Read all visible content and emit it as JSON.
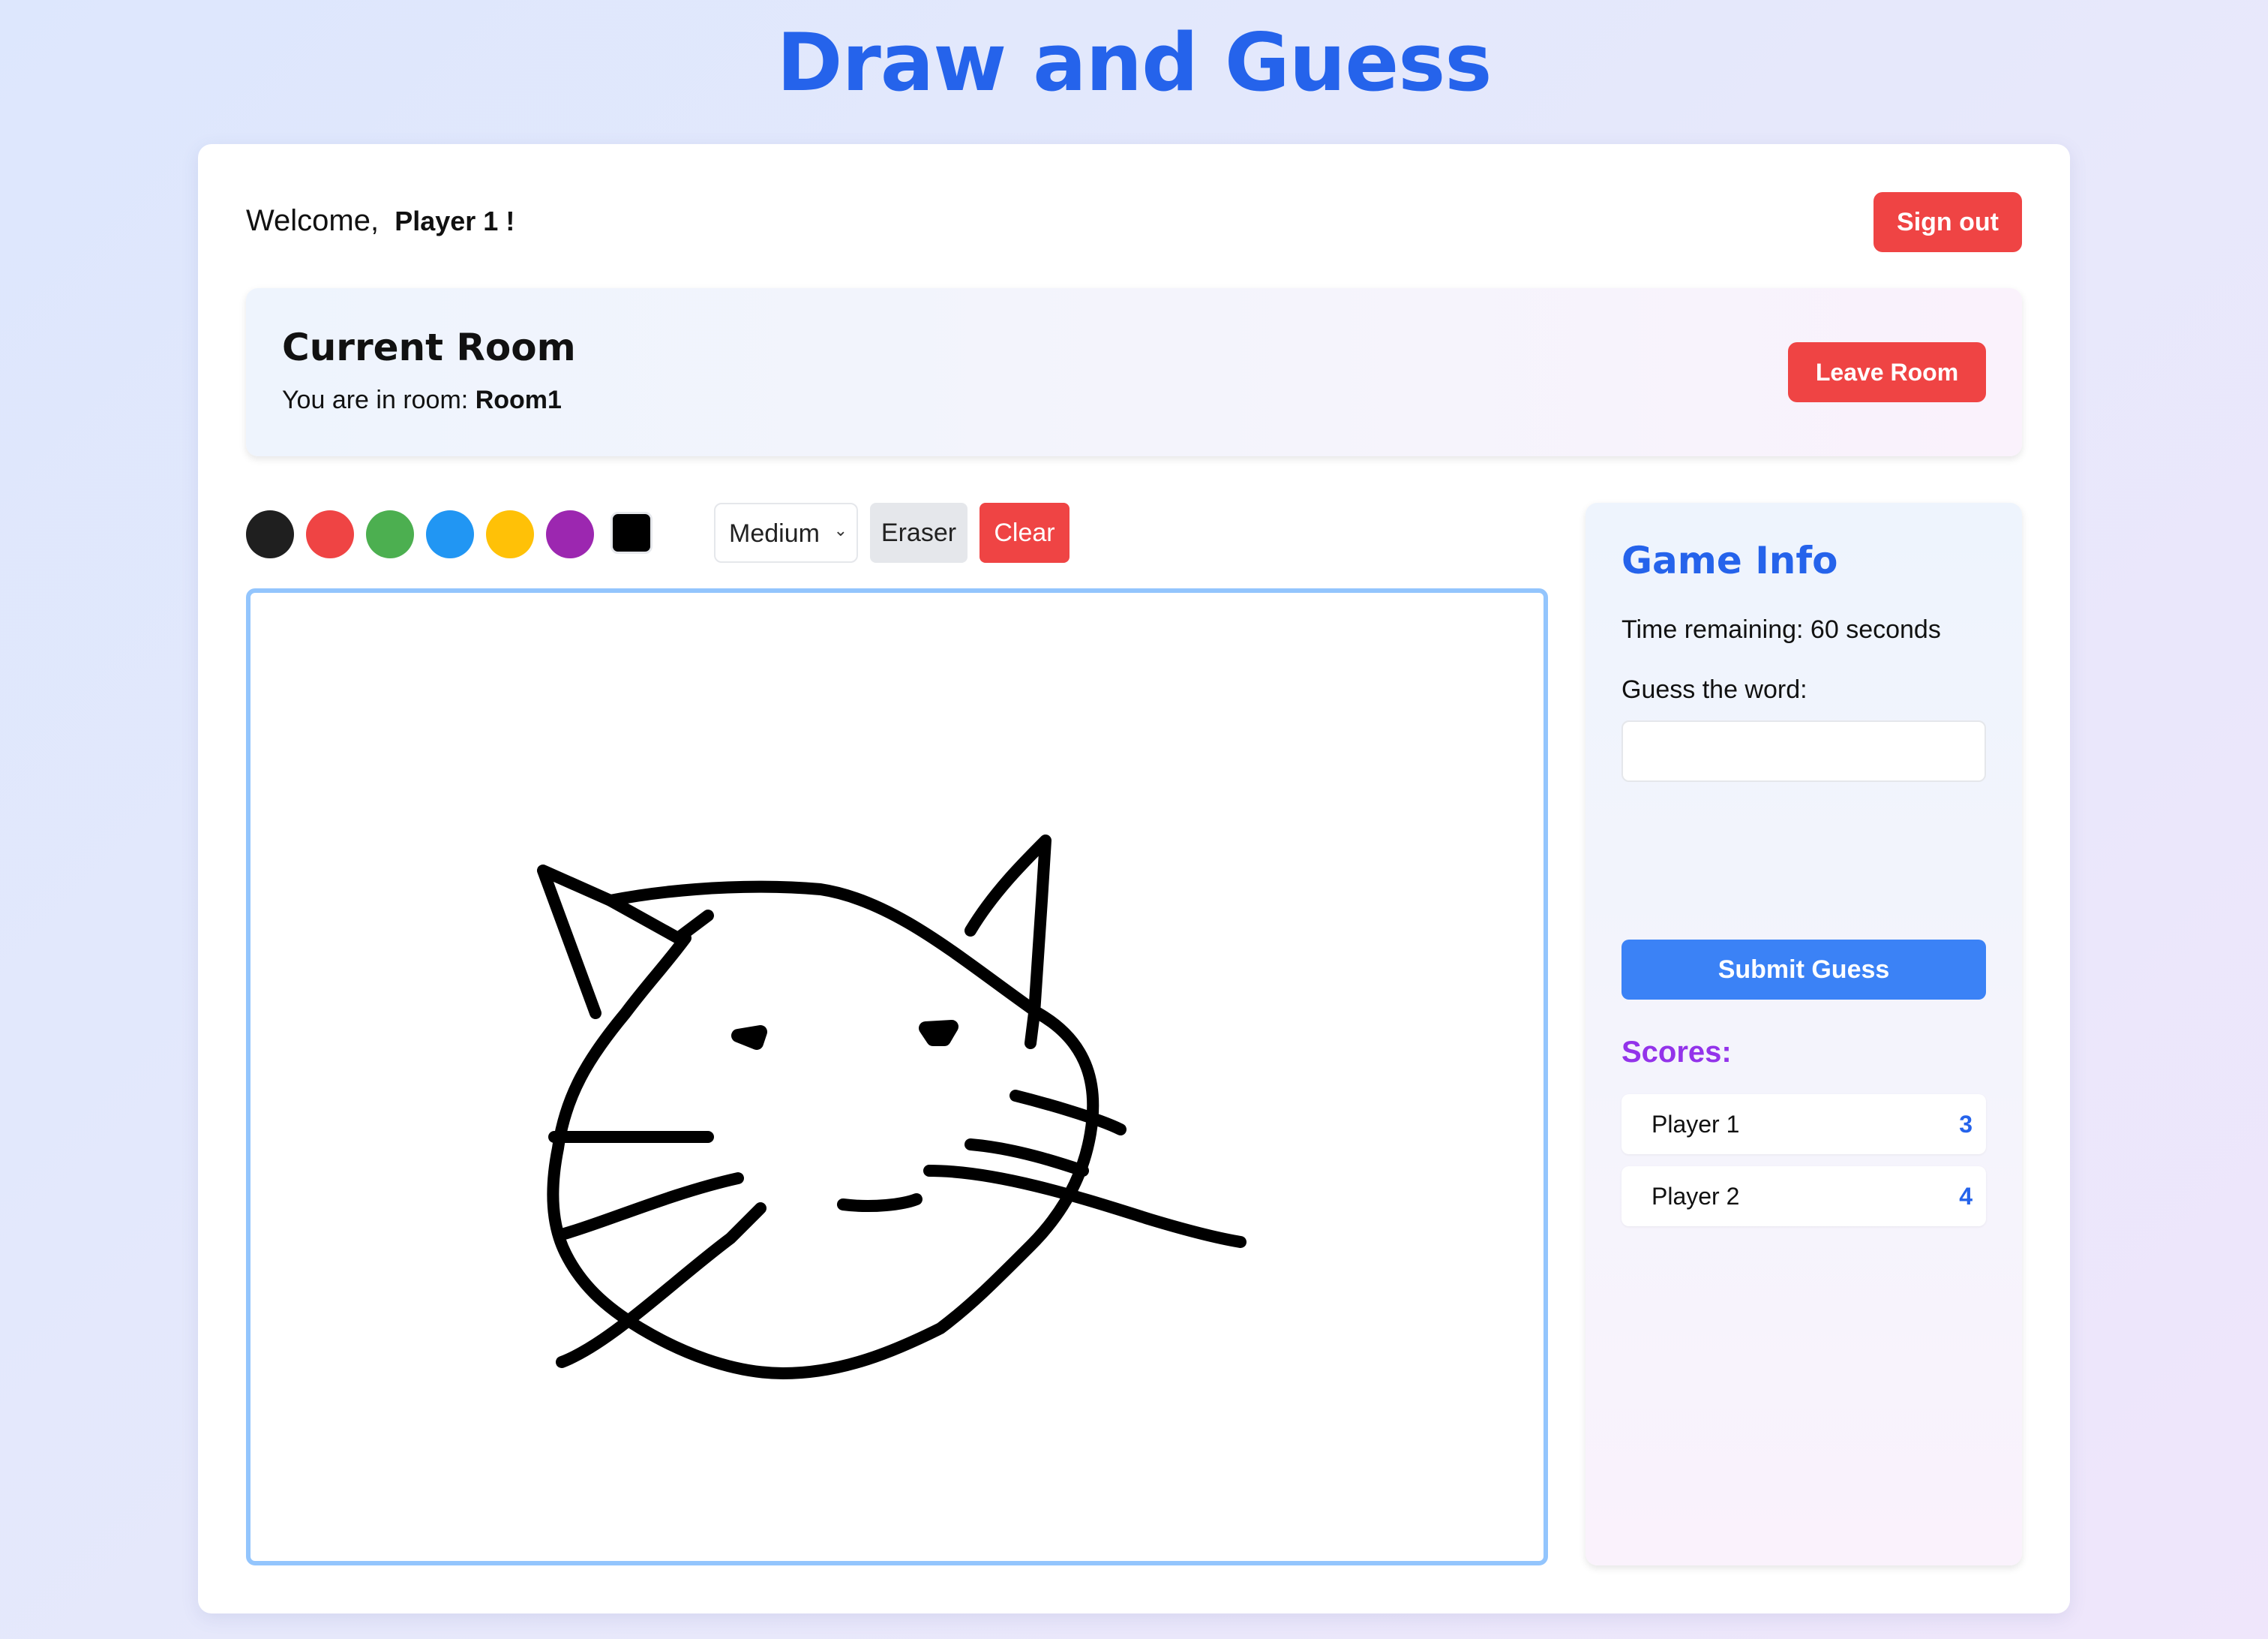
{
  "app": {
    "title": "Draw and Guess"
  },
  "header": {
    "welcome_prefix": "Welcome,",
    "player_name": "Player 1 !",
    "signout_label": "Sign out"
  },
  "room": {
    "heading": "Current Room",
    "line_prefix": "You are in room:",
    "name": "Room1",
    "leave_label": "Leave Room"
  },
  "toolbar": {
    "colors": [
      "#1f1f1f",
      "#ef4444",
      "#4caf50",
      "#2196f3",
      "#ffc107",
      "#9c27b0"
    ],
    "picker_color": "#000000",
    "brush_size": "Medium",
    "eraser_label": "Eraser",
    "clear_label": "Clear"
  },
  "game_info": {
    "title": "Game Info",
    "time_remaining": "Time remaining: 60 seconds",
    "guess_label": "Guess the word:",
    "guess_value": "",
    "submit_label": "Submit Guess",
    "scores_heading": "Scores:",
    "scores": [
      {
        "name": "Player 1",
        "score": "3"
      },
      {
        "name": "Player 2",
        "score": "4"
      }
    ]
  },
  "colors": {
    "accent": "#2563eb",
    "danger": "#ef4444",
    "primary_button": "#3b82f6",
    "scores_heading": "#9333ea",
    "canvas_border": "#93c5fd"
  }
}
